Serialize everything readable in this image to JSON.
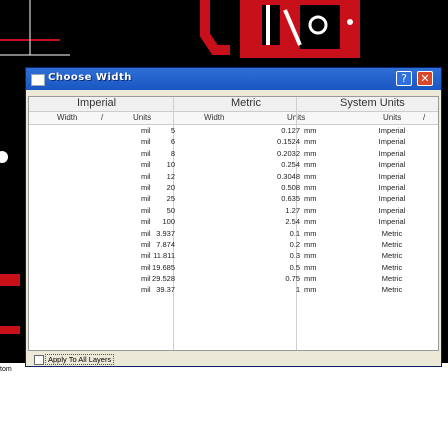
{
  "dialog": {
    "title": "Choose Width",
    "help_label": "?",
    "close_label": "✕"
  },
  "groups": {
    "imperial": "Imperial",
    "metric": "Metric",
    "system_units": "System Units"
  },
  "columns": {
    "imperial_width": "Width",
    "imperial_units": "Units",
    "metric_width": "Width",
    "metric_units": "Units",
    "system_units": "Units"
  },
  "rows": [
    {
      "iw": "5",
      "iu": "mil",
      "mw": "0.127",
      "mu": "mm",
      "su": "Imperial"
    },
    {
      "iw": "6",
      "iu": "mil",
      "mw": "0.1524",
      "mu": "mm",
      "su": "Imperial"
    },
    {
      "iw": "8",
      "iu": "mil",
      "mw": "0.2032",
      "mu": "mm",
      "su": "Imperial"
    },
    {
      "iw": "10",
      "iu": "mil",
      "mw": "0.254",
      "mu": "mm",
      "su": "Imperial"
    },
    {
      "iw": "12",
      "iu": "mil",
      "mw": "0.3048",
      "mu": "mm",
      "su": "Imperial"
    },
    {
      "iw": "20",
      "iu": "mil",
      "mw": "0.508",
      "mu": "mm",
      "su": "Imperial"
    },
    {
      "iw": "25",
      "iu": "mil",
      "mw": "0.635",
      "mu": "mm",
      "su": "Imperial"
    },
    {
      "iw": "50",
      "iu": "mil",
      "mw": "1.27",
      "mu": "mm",
      "su": "Imperial"
    },
    {
      "iw": "100",
      "iu": "mil",
      "mw": "2.54",
      "mu": "mm",
      "su": "Imperial"
    },
    {
      "iw": "3.937",
      "iu": "mil",
      "mw": "0.1",
      "mu": "mm",
      "su": "Metric"
    },
    {
      "iw": "7.874",
      "iu": "mil",
      "mw": "0.2",
      "mu": "mm",
      "su": "Metric"
    },
    {
      "iw": "11.811",
      "iu": "mil",
      "mw": "0.3",
      "mu": "mm",
      "su": "Metric"
    },
    {
      "iw": "19.685",
      "iu": "mil",
      "mw": "0.5",
      "mu": "mm",
      "su": "Metric"
    },
    {
      "iw": "29.528",
      "iu": "mil",
      "mw": "0.75",
      "mu": "mm",
      "su": "Metric"
    },
    {
      "iw": "39.37",
      "iu": "mil",
      "mw": "1",
      "mu": "mm",
      "su": "Metric"
    }
  ],
  "footer": {
    "apply_all_layers": "Apply To All Layers"
  },
  "background": {
    "partial_label": "tom"
  },
  "colors": {
    "titlebar": "#1b56c2",
    "dialog_bg": "#ece9d8",
    "pcb_red": "#c8101a"
  }
}
